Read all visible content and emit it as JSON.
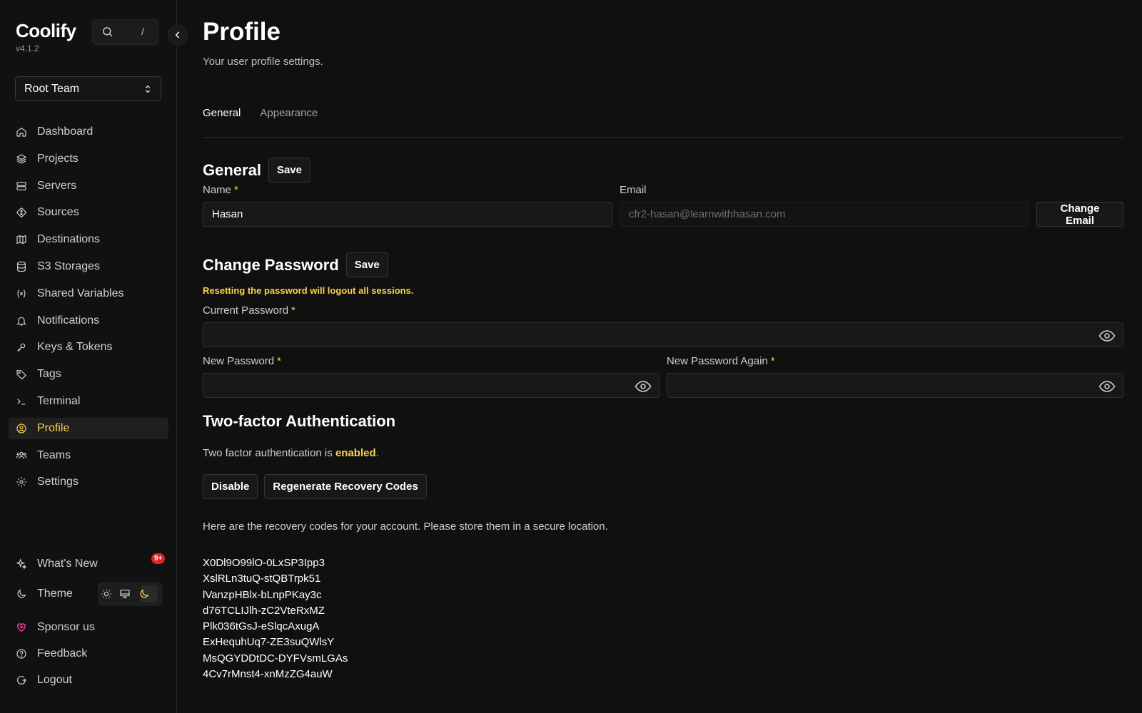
{
  "brand": {
    "name": "Coolify",
    "version": "v4.1.2"
  },
  "search": {
    "shortcut": "/"
  },
  "team": {
    "selected": "Root Team"
  },
  "nav": {
    "items": [
      {
        "label": "Dashboard",
        "icon": "home-icon"
      },
      {
        "label": "Projects",
        "icon": "layers-icon"
      },
      {
        "label": "Servers",
        "icon": "server-icon"
      },
      {
        "label": "Sources",
        "icon": "git-icon"
      },
      {
        "label": "Destinations",
        "icon": "map-icon"
      },
      {
        "label": "S3 Storages",
        "icon": "database-icon"
      },
      {
        "label": "Shared Variables",
        "icon": "variable-icon"
      },
      {
        "label": "Notifications",
        "icon": "bell-icon"
      },
      {
        "label": "Keys & Tokens",
        "icon": "key-icon"
      },
      {
        "label": "Tags",
        "icon": "tag-icon"
      },
      {
        "label": "Terminal",
        "icon": "terminal-icon"
      },
      {
        "label": "Profile",
        "icon": "user-circle-icon",
        "active": true
      },
      {
        "label": "Teams",
        "icon": "users-icon"
      },
      {
        "label": "Settings",
        "icon": "gear-icon"
      }
    ],
    "whats_new": "What's New",
    "whats_new_badge": "9+",
    "theme": "Theme",
    "sponsor": "Sponsor us",
    "feedback": "Feedback",
    "logout": "Logout"
  },
  "page": {
    "title": "Profile",
    "subtitle": "Your user profile settings.",
    "tabs": [
      "General",
      "Appearance"
    ]
  },
  "general": {
    "heading": "General",
    "save": "Save",
    "name_label": "Name",
    "name_value": "Hasan",
    "email_label": "Email",
    "email_value": "cfr2-hasan@learnwithhasan.com",
    "change_email": "Change Email"
  },
  "password": {
    "heading": "Change Password",
    "save": "Save",
    "warning": "Resetting the password will logout all sessions.",
    "current_label": "Current Password",
    "new_label": "New Password",
    "again_label": "New Password Again"
  },
  "tfa": {
    "heading": "Two-factor Authentication",
    "text_prefix": "Two factor authentication is ",
    "status": "enabled",
    "text_suffix": ".",
    "disable": "Disable",
    "regenerate": "Regenerate Recovery Codes",
    "note": "Here are the recovery codes for your account. Please store them in a secure location.",
    "codes": [
      "X0Dl9O99lO-0LxSP3Ipp3",
      "XslRLn3tuQ-stQBTrpk51",
      "lVanzpHBlx-bLnpPKay3c",
      "d76TCLIJlh-zC2VteRxMZ",
      "Plk036tGsJ-eSlqcAxugA",
      "ExHequhUq7-ZE3suQWlsY",
      "MsQGYDDtDC-DYFVsmLGAs",
      "4Cv7rMnst4-xnMzZG4auW"
    ]
  },
  "colors": {
    "accent": "#fcd34d",
    "background": "#101010",
    "badge": "#dc2626",
    "sponsor": "#ec4899"
  }
}
